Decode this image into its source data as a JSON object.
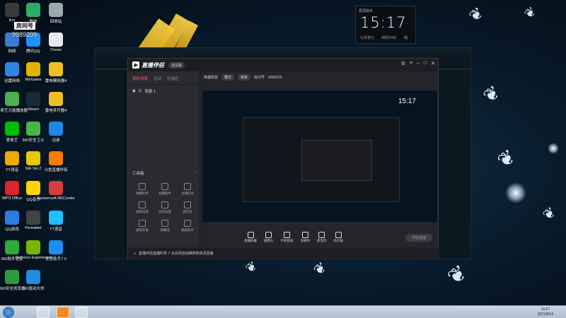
{
  "desktop": {
    "icons_col1": [
      {
        "label": "ilcu",
        "icon": "ilcu-icon",
        "color": "#3a3a3a"
      },
      {
        "label": "网络",
        "icon": "network-icon",
        "color": "#3b7bd8"
      },
      {
        "label": "迅雷网络",
        "icon": "xunlei-icon",
        "color": "#2f86e0"
      },
      {
        "label": "爱奇艺万能播放器",
        "icon": "iqiyi-player-icon",
        "color": "#4caf50"
      },
      {
        "label": "爱奇艺",
        "icon": "iqiyi-icon",
        "color": "#00be06"
      },
      {
        "label": "YY语音",
        "icon": "yy-icon",
        "color": "#f0a800"
      },
      {
        "label": "WPS Office",
        "icon": "wps-icon",
        "color": "#d8262c"
      },
      {
        "label": "QQ游戏",
        "icon": "qqgame-icon",
        "color": "#2a7de1"
      },
      {
        "label": "360软件管家",
        "icon": "360-software-icon",
        "color": "#31a838"
      },
      {
        "label": "360安全浏览器",
        "icon": "360-browser-icon",
        "color": "#2c9a3a"
      }
    ],
    "icons_col2": [
      {
        "label": "微信",
        "icon": "wechat-icon",
        "color": "#2aae67"
      },
      {
        "label": "腾讯QQ",
        "icon": "qq-icon",
        "color": "#1e90ff"
      },
      {
        "label": "WeGame",
        "icon": "wegame-icon",
        "color": "#e0b400"
      },
      {
        "label": "Steam",
        "icon": "steam-icon",
        "color": "#1b2838"
      },
      {
        "label": "360安全卫士",
        "icon": "360-guard-icon",
        "color": "#48b549"
      },
      {
        "label": "SAI Ver.2",
        "icon": "sai-icon",
        "color": "#e6c800"
      },
      {
        "label": "QQ音乐",
        "icon": "qqmusic-icon",
        "color": "#ffd400"
      },
      {
        "label": "Pentablet",
        "icon": "pentablet-icon",
        "color": "#444"
      },
      {
        "label": "GeForce Experience",
        "icon": "geforce-icon",
        "color": "#76b900"
      },
      {
        "label": "360驱动大师",
        "icon": "360-driver-icon",
        "color": "#1f8de0"
      }
    ],
    "icons_col3": [
      {
        "label": "回收站",
        "icon": "recycle-bin-icon",
        "color": "#9aa"
      },
      {
        "label": "iTunes",
        "icon": "itunes-icon",
        "color": "#e8e8e8"
      },
      {
        "label": "雷电模拟器4",
        "icon": "ldplayer-icon",
        "color": "#f0c020"
      },
      {
        "label": "雷电多开器4",
        "icon": "ldmulti-icon",
        "color": "#f0c020"
      },
      {
        "label": "迅游",
        "icon": "xunyou-icon",
        "color": "#1e88e5"
      },
      {
        "label": "斗鱼直播伴侣",
        "icon": "douyu-icon",
        "color": "#ff7a00"
      },
      {
        "label": "Apowersoft RECorder",
        "icon": "apowerrec-icon",
        "color": "#d83b3b"
      },
      {
        "label": "TT语音",
        "icon": "tt-icon",
        "color": "#1ec0ff"
      },
      {
        "label": "爱思助手7.0",
        "icon": "aisi-icon",
        "color": "#1b8ef0"
      }
    ],
    "room_label": "房间号",
    "room_number": "9989209"
  },
  "clock_widget": {
    "app_name": "爱思助手",
    "time": "15:17",
    "date": "七月初七",
    "weekday": "08月14日",
    "weather": "晴"
  },
  "live_app": {
    "title": "直播伴侣",
    "version_badge": "测试版",
    "tabs": [
      "我的场景",
      "互动",
      "可选区"
    ],
    "scene_name": "场景 1",
    "tools_header": "工具箱",
    "tools": [
      {
        "label": "弹幕助手",
        "icon": "danmaku-icon"
      },
      {
        "label": "直播助手",
        "icon": "live-helper-icon"
      },
      {
        "label": "主播任务",
        "icon": "anchor-task-icon"
      },
      {
        "label": "视频连麦",
        "icon": "video-link-icon"
      },
      {
        "label": "房间设置",
        "icon": "room-settings-icon"
      },
      {
        "label": "调音台",
        "icon": "mixer-icon"
      },
      {
        "label": "虚拟形象",
        "icon": "avatar-icon"
      },
      {
        "label": "弹幕墙",
        "icon": "danmaku-wall-icon"
      },
      {
        "label": "数据助手",
        "icon": "data-helper-icon"
      }
    ],
    "topbar": {
      "game_label": "英雄联盟",
      "chip1": "模式",
      "chip2": "帧率",
      "room_label": "房间号",
      "room_id": "9989209"
    },
    "bottom_controls": [
      "直播屏幕",
      "摄像头",
      "手机投屏",
      "多媒体",
      "麦克风",
      "扬声器"
    ],
    "start_label": "开始直播",
    "notice": "直播伴侣直播时将 7 点关闭自动推荐和高清直播"
  },
  "taskbar": {
    "time": "15:27",
    "date": "2021/8/14"
  }
}
